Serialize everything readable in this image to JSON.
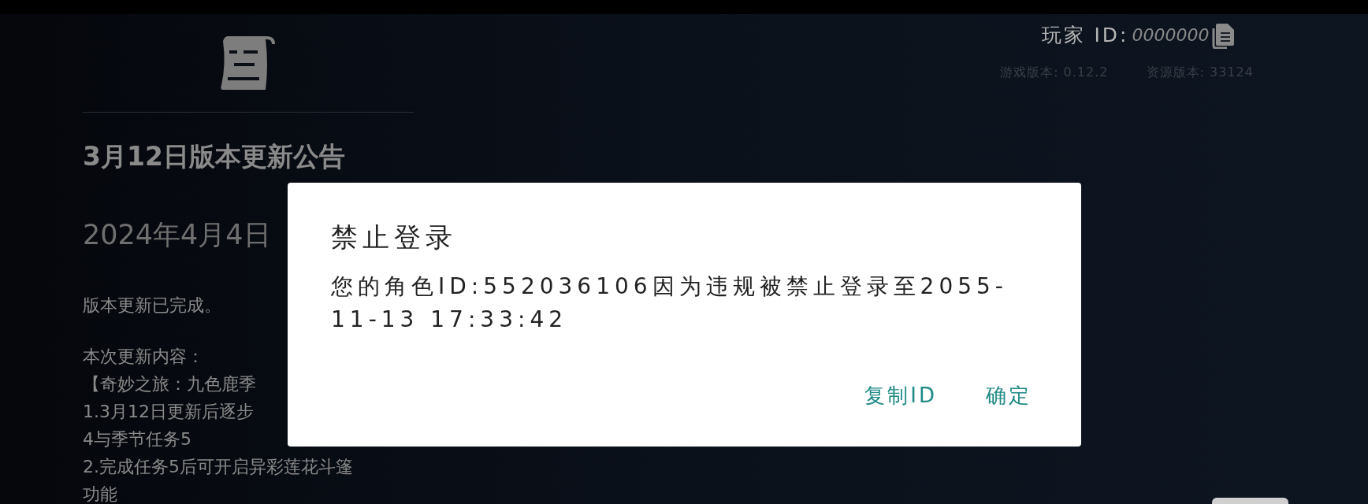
{
  "announcement": {
    "title": "3月12日版本更新公告",
    "date": "2024年4月4日",
    "lines": [
      "版本更新已完成。",
      "本次更新内容：",
      "【奇妙之旅：九色鹿季",
      "1.3月12日更新后逐步",
      "4与季节任务5",
      "2.完成任务5后可开启异彩莲花斗篷",
      "功能"
    ]
  },
  "player": {
    "id_label": "玩家 ID:",
    "id_value": "0000000",
    "game_version": "游戏版本: 0.12.2",
    "resource_version": "资源版本: 33124"
  },
  "dialog": {
    "title": "禁止登录",
    "message": "您的角色ID:552036106因为违规被禁止登录至2055-11-13 17:33:42",
    "buttons": [
      "复制ID",
      "确定"
    ]
  }
}
